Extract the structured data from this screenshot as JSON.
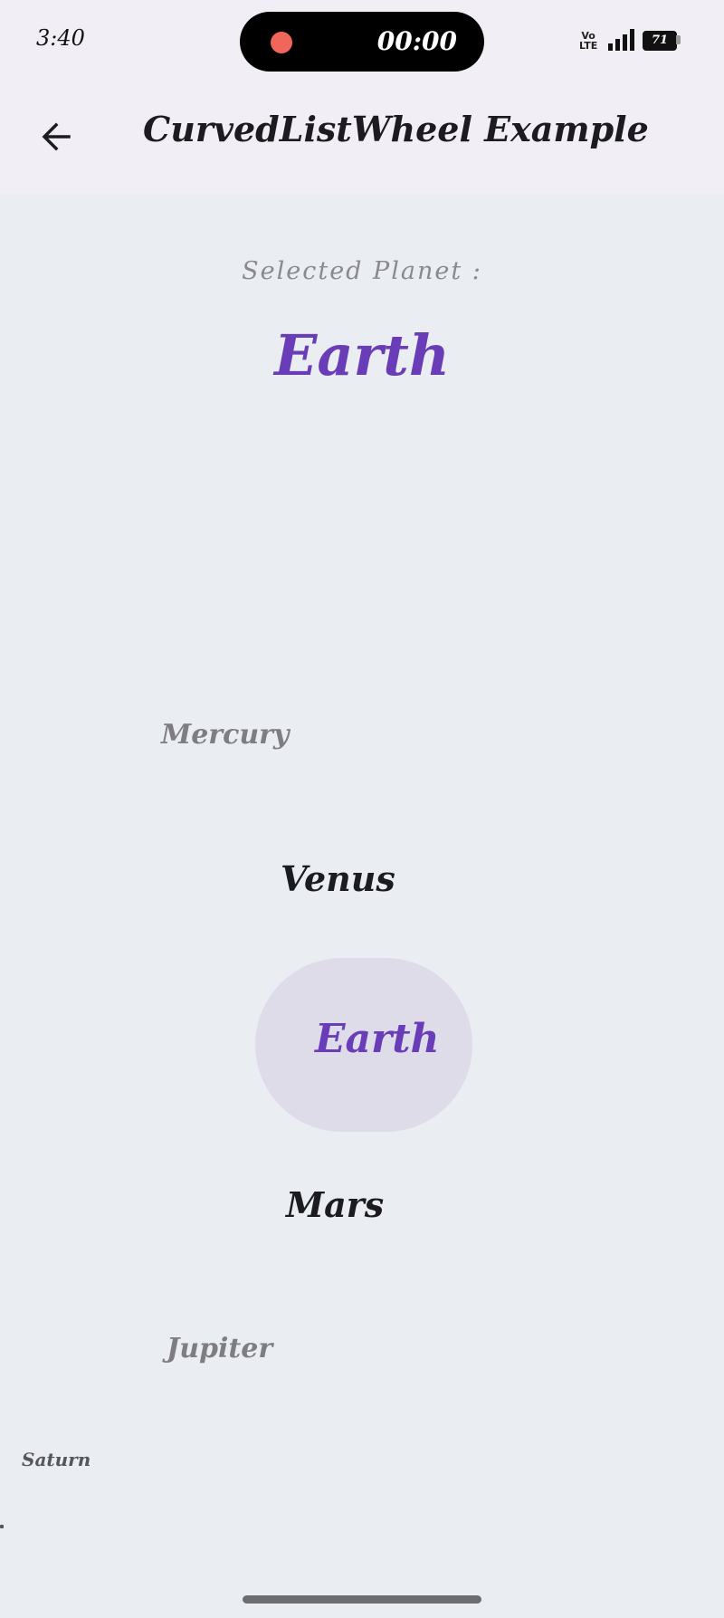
{
  "status_bar": {
    "time": "3:40",
    "recording_timer": "00:00",
    "network_label": "Vo\nLTE",
    "battery_level": "71",
    "icons": [
      "recording-dot-icon",
      "signal-icon",
      "battery-icon"
    ]
  },
  "app_bar": {
    "title": "CurvedListWheel Example",
    "back_icon": "arrow-left-icon"
  },
  "selection": {
    "label": "Selected Planet :",
    "value": "Earth"
  },
  "wheel": {
    "items": [
      "Mercury",
      "Venus",
      "Earth",
      "Mars",
      "Jupiter",
      "Saturn"
    ],
    "selected_index": 2
  },
  "colors": {
    "accent": "#6a3db8",
    "background": "#eaedf1",
    "app_bar_background": "#f1eff5",
    "selected_highlight": "#dfdcea",
    "recording_dot": "#f0665a"
  }
}
